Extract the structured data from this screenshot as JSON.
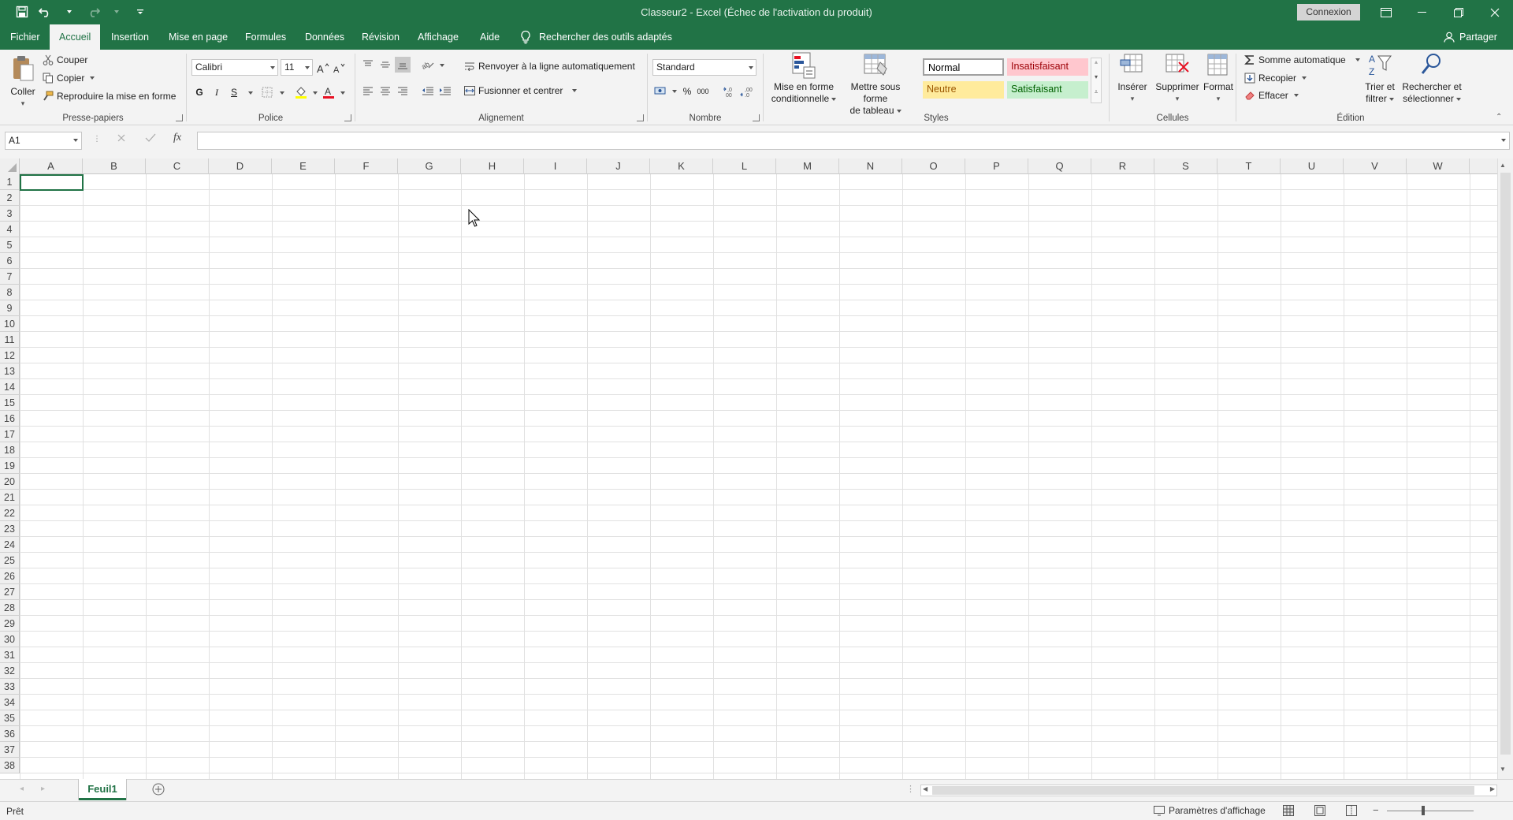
{
  "app": {
    "title": "Classeur2  -  Excel (Échec de l'activation du produit)",
    "connexion": "Connexion"
  },
  "icons": {
    "save": "save-icon",
    "undo": "undo-icon",
    "redo": "redo-icon",
    "customize": "customize-qat-icon",
    "minimize": "minimize-icon",
    "restore": "restore-icon",
    "close": "close-icon",
    "lightbulb": "lightbulb-icon",
    "person": "person-icon"
  },
  "colors": {
    "accent": "#217346",
    "bad_bg": "#ffc7ce",
    "bad_fg": "#9c0006",
    "neutral_bg": "#ffeb9c",
    "neutral_fg": "#9c5700",
    "good_bg": "#c6efce",
    "good_fg": "#006100"
  },
  "tabs": [
    {
      "label": "Fichier"
    },
    {
      "label": "Accueil"
    },
    {
      "label": "Insertion"
    },
    {
      "label": "Mise en page"
    },
    {
      "label": "Formules"
    },
    {
      "label": "Données"
    },
    {
      "label": "Révision"
    },
    {
      "label": "Affichage"
    },
    {
      "label": "Aide"
    }
  ],
  "active_tab": "Accueil",
  "tell_me": "Rechercher des outils adaptés",
  "share": "Partager",
  "ribbon": {
    "clipboard": {
      "label": "Presse-papiers",
      "paste": "Coller",
      "cut": "Couper",
      "copy": "Copier",
      "format_painter": "Reproduire la mise en forme"
    },
    "font": {
      "label": "Police",
      "name": "Calibri",
      "size": "11",
      "bold": "G",
      "italic": "I",
      "underline": "S"
    },
    "alignment": {
      "label": "Alignement",
      "wrap": "Renvoyer à la ligne automatiquement",
      "merge": "Fusionner et centrer"
    },
    "number": {
      "label": "Nombre",
      "format": "Standard",
      "percent": "%",
      "thousands": "000"
    },
    "styles": {
      "label": "Styles",
      "conditional": [
        "Mise en forme",
        "conditionnelle"
      ],
      "table": [
        "Mettre sous forme",
        "de tableau"
      ],
      "normal": "Normal",
      "bad": "Insatisfaisant",
      "neutral": "Neutre",
      "good": "Satisfaisant"
    },
    "cells": {
      "label": "Cellules",
      "insert": "Insérer",
      "delete": "Supprimer",
      "format": "Format"
    },
    "editing": {
      "label": "Édition",
      "autosum": "Somme automatique",
      "fill": "Recopier",
      "clear": "Effacer",
      "sort": [
        "Trier et",
        "filtrer"
      ],
      "find": [
        "Rechercher et",
        "sélectionner"
      ]
    }
  },
  "formula_bar": {
    "name_box": "A1",
    "fx": "fx",
    "value": ""
  },
  "columns": [
    "A",
    "B",
    "C",
    "D",
    "E",
    "F",
    "G",
    "H",
    "I",
    "J",
    "K",
    "L",
    "M",
    "N",
    "O",
    "P",
    "Q",
    "R",
    "S",
    "T",
    "U",
    "V",
    "W"
  ],
  "rows": [
    "1",
    "2",
    "3",
    "4",
    "5",
    "6",
    "7",
    "8",
    "9",
    "10",
    "11",
    "12",
    "13",
    "14",
    "15",
    "16",
    "17",
    "18",
    "19",
    "20",
    "21",
    "22",
    "23",
    "24",
    "25",
    "26",
    "27",
    "28",
    "29",
    "30",
    "31",
    "32",
    "33",
    "34",
    "35",
    "36",
    "37",
    "38"
  ],
  "sheets": [
    {
      "name": "Feuil1",
      "active": true
    }
  ],
  "status": {
    "ready": "Prêt",
    "display_settings": "Paramètres d'affichage"
  }
}
